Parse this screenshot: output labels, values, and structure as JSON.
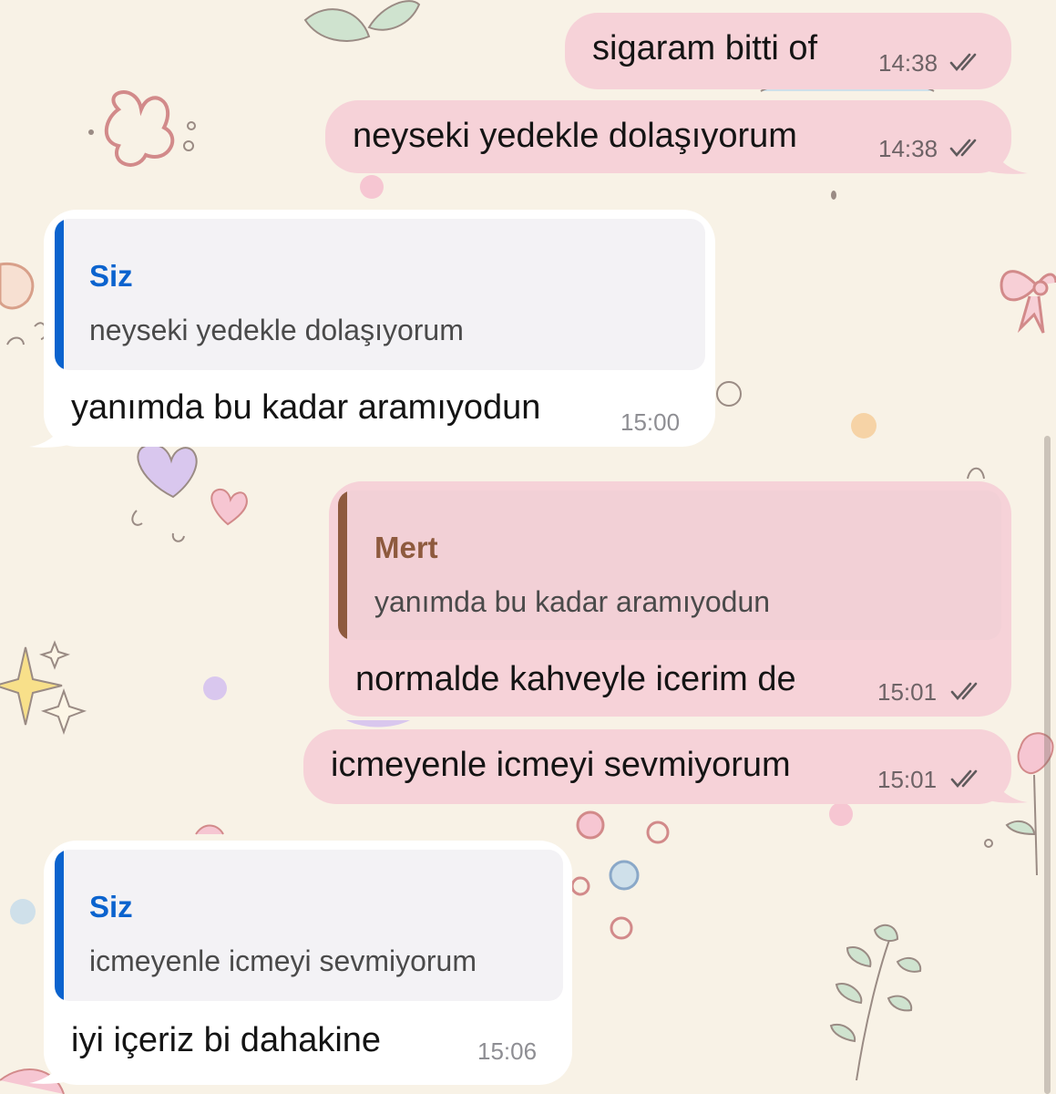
{
  "chat": {
    "messages": [
      {
        "direction": "outgoing",
        "text": "sigaram bitti of",
        "time": "14:38",
        "status": "read-double-check-icon"
      },
      {
        "direction": "outgoing",
        "text": "neyseki yedekle dolaşıyorum",
        "time": "14:38",
        "status": "read-double-check-icon"
      },
      {
        "direction": "incoming",
        "reply": {
          "author": "Siz",
          "text": "neyseki yedekle dolaşıyorum"
        },
        "text": "yanımda bu kadar aramıyodun",
        "time": "15:00"
      },
      {
        "direction": "outgoing",
        "reply": {
          "author": "Mert",
          "text": "yanımda bu kadar aramıyodun"
        },
        "text": "normalde kahveyle icerim de",
        "time": "15:01",
        "status": "read-double-check-icon"
      },
      {
        "direction": "outgoing",
        "text": "icmeyenle icmeyi sevmiyorum",
        "time": "15:01",
        "status": "read-double-check-icon"
      },
      {
        "direction": "incoming",
        "reply": {
          "author": "Siz",
          "text": "icmeyenle icmeyi sevmiyorum"
        },
        "text": "iyi içeriz bi dahakine",
        "time": "15:06"
      }
    ]
  },
  "colors": {
    "background": "#f8f2e6",
    "outgoing_bubble": "#f6d2d8",
    "incoming_bubble": "#ffffff",
    "reply_bar_incoming": "#0b63ce",
    "reply_bar_outgoing": "#8e5a3e"
  }
}
